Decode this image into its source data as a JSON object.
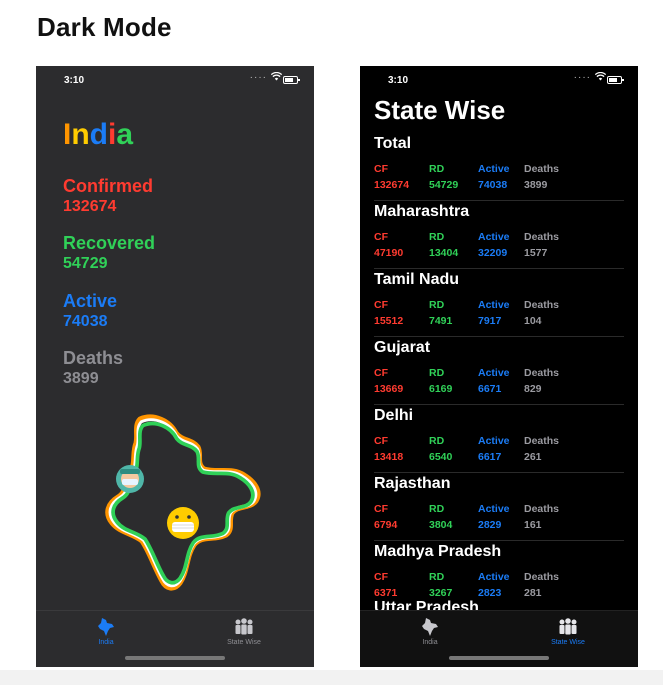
{
  "heading": "Dark Mode",
  "colors": {
    "confirmed": "#ff3b30",
    "recovered": "#30d158",
    "active": "#1b7cf6",
    "deaths": "#8e8e93",
    "deaths_state": "#9b9ba1",
    "india_i1": "#ff9500",
    "india_n": "#ffcc00",
    "india_d": "#1b7cf6",
    "india_i2": "#ff3b30",
    "india_a": "#30d158",
    "tab_active": "#1b7cf6",
    "tab_inactive": "#8e8e93"
  },
  "left_phone": {
    "time": "3:10",
    "title_letters": [
      "I",
      "n",
      "d",
      "i",
      "a"
    ],
    "stats": [
      {
        "label": "Confirmed",
        "value": "132674",
        "color_key": "confirmed"
      },
      {
        "label": "Recovered",
        "value": "54729",
        "color_key": "recovered"
      },
      {
        "label": "Active",
        "value": "74038",
        "color_key": "active"
      },
      {
        "label": "Deaths",
        "value": "3899",
        "color_key": "deaths"
      }
    ],
    "tabs": [
      {
        "label": "India",
        "icon": "india-map-icon",
        "active": true
      },
      {
        "label": "State Wise",
        "icon": "people-icon",
        "active": false
      }
    ]
  },
  "right_phone": {
    "time": "3:10",
    "title": "State Wise",
    "column_keys": {
      "cf": "CF",
      "rd": "RD",
      "active": "Active",
      "deaths": "Deaths"
    },
    "states": [
      {
        "name": "Total",
        "cf": "132674",
        "rd": "54729",
        "active": "74038",
        "deaths": "3899"
      },
      {
        "name": "Maharashtra",
        "cf": "47190",
        "rd": "13404",
        "active": "32209",
        "deaths": "1577"
      },
      {
        "name": "Tamil Nadu",
        "cf": "15512",
        "rd": "7491",
        "active": "7917",
        "deaths": "104"
      },
      {
        "name": "Gujarat",
        "cf": "13669",
        "rd": "6169",
        "active": "6671",
        "deaths": "829"
      },
      {
        "name": "Delhi",
        "cf": "13418",
        "rd": "6540",
        "active": "6617",
        "deaths": "261"
      },
      {
        "name": "Rajasthan",
        "cf": "6794",
        "rd": "3804",
        "active": "2829",
        "deaths": "161"
      },
      {
        "name": "Madhya Pradesh",
        "cf": "6371",
        "rd": "3267",
        "active": "2823",
        "deaths": "281"
      }
    ],
    "peek_name": "Uttar Pradesh",
    "tabs": [
      {
        "label": "India",
        "icon": "india-map-icon",
        "active": false
      },
      {
        "label": "State Wise",
        "icon": "people-icon",
        "active": true
      }
    ]
  }
}
